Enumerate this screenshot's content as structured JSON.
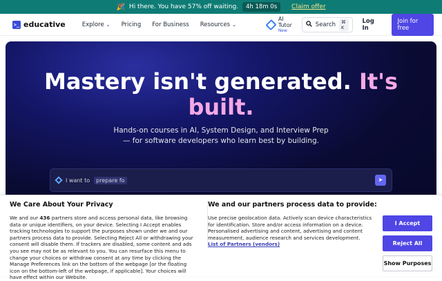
{
  "promo": {
    "message": "Hi there. You have 57% off waiting.",
    "timer": "4h 18m 0s",
    "cta": "Claim offer"
  },
  "nav": {
    "logo": "educative",
    "links": [
      {
        "label": "Explore"
      },
      {
        "label": "Pricing"
      },
      {
        "label": "For Business"
      },
      {
        "label": "Resources"
      }
    ],
    "ai_tutor": {
      "label": "AI Tutor",
      "badge": "New"
    },
    "search": {
      "label": "Search",
      "shortcut": "⌘ K"
    },
    "login": "Log In",
    "join": "Join for free"
  },
  "hero": {
    "headline_main": "Mastery isn't generated.",
    "headline_accent_a": "It's",
    "headline_accent_b": "built.",
    "sub_line1": "Hands-on courses in AI, System Design, and Interview Prep",
    "sub_line2": "— for software developers who learn best by building.",
    "prompt_prefix": "I want to",
    "prompt_typed": "prepare fo"
  },
  "consent": {
    "title_left": "We Care About Your Privacy",
    "body_left_a": "We and our ",
    "body_left_count": "436",
    "body_left_b": " partners store and access personal data, like browsing data or unique identifiers, on your device. Selecting I Accept enables tracking technologies to support the purposes shown under we and our partners process data to provide. Selecting Reject All or withdrawing your consent will disable them. If trackers are disabled, some content and ads you see may not be as relevant to you. You can resurface this menu to change your choices or withdraw consent at any time by clicking the Manage Preferences link on the bottom of the webpage [or the floating icon on the bottom-left of the webpage, if applicable]. Your choices will have effect within our Website.",
    "title_right": "We and our partners process data to provide:",
    "body_right": "Use precise geolocation data. Actively scan device characteristics for identification. Store and/or access information on a device. Personalised advertising and content, advertising and content measurement, audience research and services development.",
    "partners_link": "List of Partners (vendors)",
    "accept": "I Accept",
    "reject": "Reject All",
    "purposes": "Show Purposes"
  },
  "colors": {
    "promo_bg": "#0e7c75",
    "brand": "#4f46e5",
    "hero_bg": "#0a0b33",
    "accent_pink": "#f5a8e6"
  }
}
